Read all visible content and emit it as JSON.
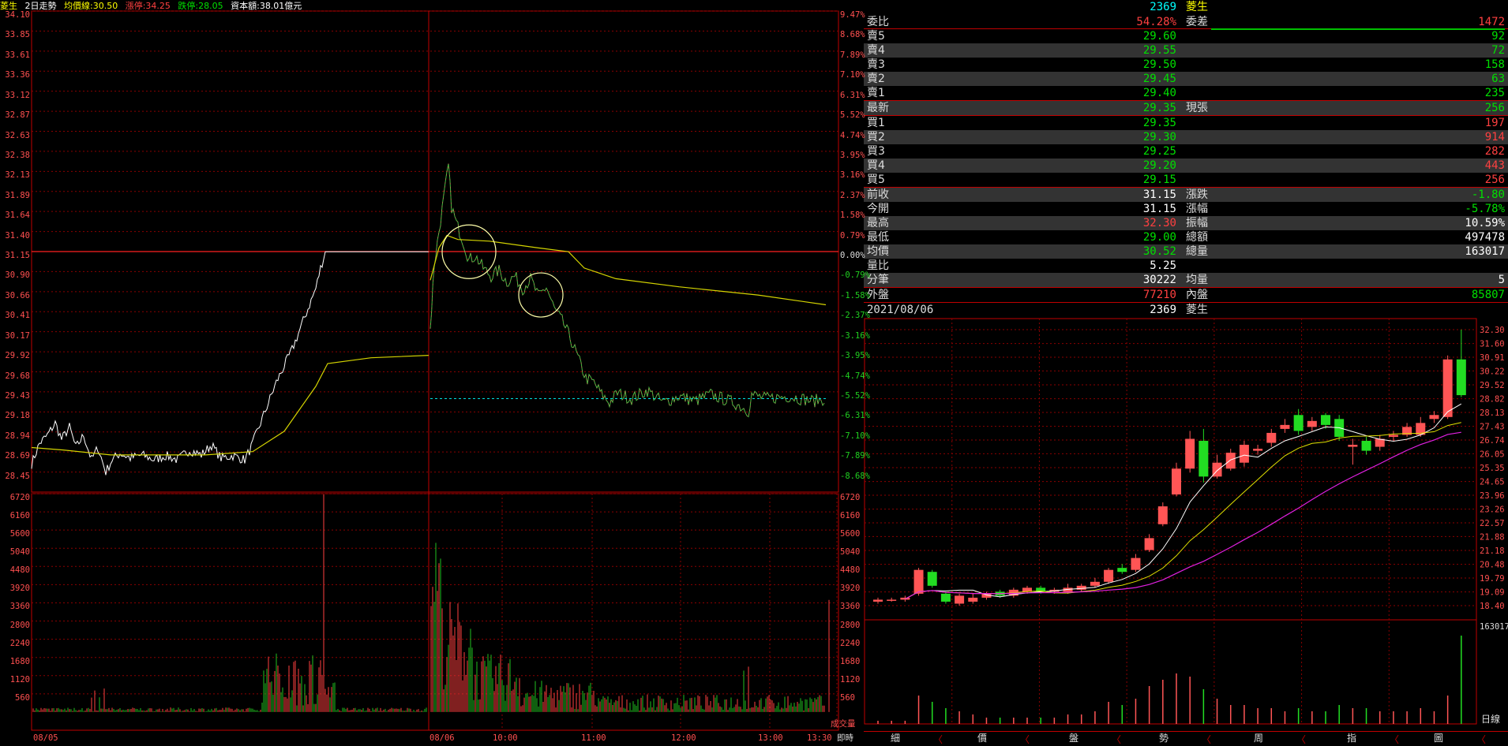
{
  "header": {
    "stock": "菱生",
    "mode": "2日走勢",
    "avg_label": "均價線:30.50",
    "limit_up": "漲停:34.25",
    "limit_down": "跌停:28.05",
    "turnover": "資本額:38.01億元"
  },
  "intraday": {
    "price_axis": [
      "34.10",
      "33.85",
      "33.61",
      "33.36",
      "33.12",
      "32.87",
      "32.63",
      "32.38",
      "32.13",
      "31.89",
      "31.64",
      "31.40",
      "31.15",
      "30.90",
      "30.66",
      "30.41",
      "30.17",
      "29.92",
      "29.68",
      "29.43",
      "29.18",
      "28.94",
      "28.69",
      "28.45"
    ],
    "pct_axis": [
      "9.47%",
      "8.68%",
      "7.89%",
      "7.10%",
      "6.31%",
      "5.52%",
      "4.74%",
      "3.95%",
      "3.16%",
      "2.37%",
      "1.58%",
      "0.79%",
      "0.00%",
      "-0.79%",
      "-1.58%",
      "-2.37%",
      "-3.16%",
      "-3.95%",
      "-4.74%",
      "-5.52%",
      "-6.31%",
      "-7.10%",
      "-7.89%",
      "-8.68%"
    ],
    "volume_axis": [
      "6720",
      "6160",
      "5600",
      "5040",
      "4480",
      "3920",
      "3360",
      "2800",
      "2240",
      "1680",
      "1120",
      "560"
    ],
    "volume_axis_label": "成交量",
    "time_labels": [
      "08/05",
      "08/06",
      "10:00",
      "11:00",
      "12:00",
      "13:00",
      "13:30"
    ],
    "now_label": "即時",
    "prev_close": 31.15,
    "colors": {
      "grid": "#8b0000",
      "price": "#ffffff",
      "avg": "#d4d400",
      "up": "#ff4040",
      "down": "#00c000"
    }
  },
  "quote": {
    "code": "2369",
    "name": "菱生",
    "ratio": {
      "k": "委比",
      "v": "54.28%",
      "k2": "委差",
      "v2": "1472"
    },
    "asks": [
      {
        "k": "賣5",
        "v": "29.60",
        "q": "92"
      },
      {
        "k": "賣4",
        "v": "29.55",
        "q": "72"
      },
      {
        "k": "賣3",
        "v": "29.50",
        "q": "158"
      },
      {
        "k": "賣2",
        "v": "29.45",
        "q": "63"
      },
      {
        "k": "賣1",
        "v": "29.40",
        "q": "235"
      }
    ],
    "last": {
      "k": "最新",
      "v": "29.35",
      "k2": "現張",
      "v2": "256"
    },
    "bids": [
      {
        "k": "買1",
        "v": "29.35",
        "q": "197"
      },
      {
        "k": "買2",
        "v": "29.30",
        "q": "914"
      },
      {
        "k": "買3",
        "v": "29.25",
        "q": "282"
      },
      {
        "k": "買4",
        "v": "29.20",
        "q": "443"
      },
      {
        "k": "買5",
        "v": "29.15",
        "q": "256"
      }
    ],
    "stats": [
      {
        "k": "前收",
        "v": "31.15",
        "k2": "漲跌",
        "v2": "-1.80"
      },
      {
        "k": "今開",
        "v": "31.15",
        "k2": "漲幅",
        "v2": "-5.78%"
      },
      {
        "k": "最高",
        "v": "32.30",
        "k2": "振幅",
        "v2": "10.59%"
      },
      {
        "k": "最低",
        "v": "29.00",
        "k2": "總額",
        "v2": "497478"
      },
      {
        "k": "均價",
        "v": "30.52",
        "k2": "總量",
        "v2": "163017"
      },
      {
        "k": "量比",
        "v": "5.25",
        "k2": "",
        "v2": ""
      },
      {
        "k": "分筆",
        "v": "30222",
        "k2": "均量",
        "v2": "5"
      }
    ],
    "outer": {
      "k": "外盤",
      "v": "77210",
      "k2": "內盤",
      "v2": "85807"
    }
  },
  "kline": {
    "date": "2021/08/06",
    "code": "2369",
    "name": "菱生",
    "price_axis": [
      "32.30",
      "31.60",
      "30.91",
      "30.22",
      "29.52",
      "28.82",
      "28.13",
      "27.43",
      "26.74",
      "26.05",
      "25.35",
      "24.65",
      "23.96",
      "23.26",
      "22.57",
      "21.88",
      "21.18",
      "20.48",
      "19.79",
      "19.09",
      "18.40"
    ],
    "volume_label": "163017",
    "period_label": "日線"
  },
  "tabs": [
    "細",
    "價",
    "盤",
    "勢",
    "周",
    "指",
    "圖"
  ]
}
